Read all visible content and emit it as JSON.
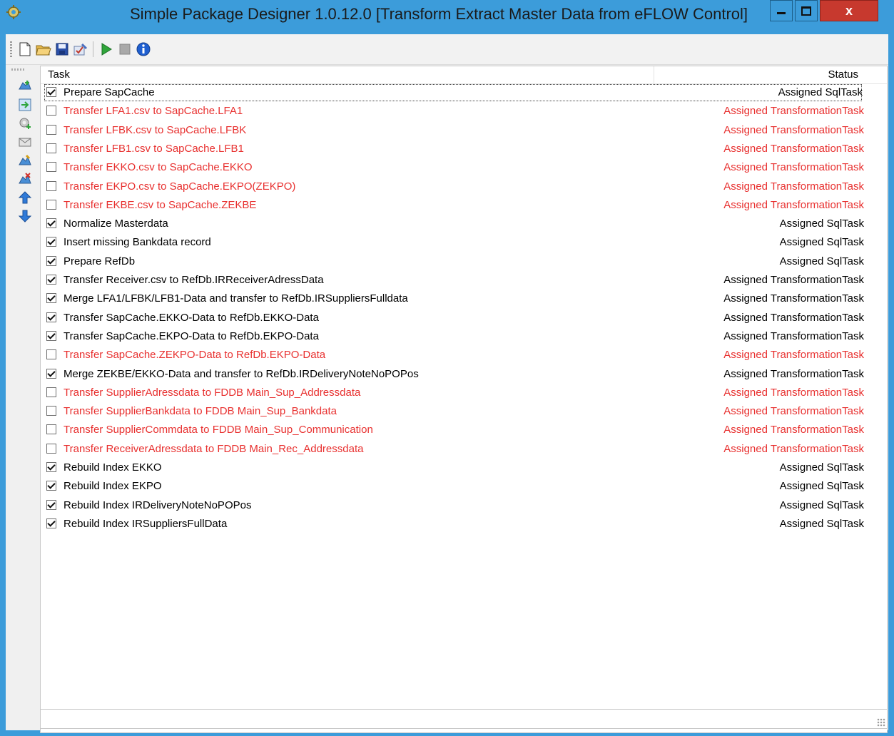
{
  "window": {
    "title": "Simple Package Designer 1.0.12.0 [Transform Extract Master Data from eFLOW Control]",
    "close_glyph": "x"
  },
  "toolbar": {
    "buttons": [
      "new-file-icon",
      "open-folder-icon",
      "save-icon",
      "edit-check-icon",
      "run-icon",
      "stop-icon",
      "info-icon"
    ]
  },
  "sidebar": {
    "buttons": [
      "add-task-icon",
      "add-transformation-icon",
      "add-sql-icon",
      "add-mail-icon",
      "edit-task-icon",
      "remove-task-icon",
      "move-up-icon",
      "move-down-icon"
    ]
  },
  "list": {
    "columns": {
      "task": "Task",
      "status": "Status"
    },
    "rows": [
      {
        "name": "Prepare SapCache",
        "status": "Assigned SqlTask",
        "checked": true,
        "color": "black"
      },
      {
        "name": "Transfer LFA1.csv to SapCache.LFA1",
        "status": "Assigned TransformationTask",
        "checked": false,
        "color": "red"
      },
      {
        "name": "Transfer LFBK.csv to SapCache.LFBK",
        "status": "Assigned TransformationTask",
        "checked": false,
        "color": "red"
      },
      {
        "name": "Transfer LFB1.csv to SapCache.LFB1",
        "status": "Assigned TransformationTask",
        "checked": false,
        "color": "red"
      },
      {
        "name": "Transfer EKKO.csv to SapCache.EKKO",
        "status": "Assigned TransformationTask",
        "checked": false,
        "color": "red"
      },
      {
        "name": "Transfer EKPO.csv to SapCache.EKPO(ZEKPO)",
        "status": "Assigned TransformationTask",
        "checked": false,
        "color": "red"
      },
      {
        "name": "Transfer EKBE.csv to SapCache.ZEKBE",
        "status": "Assigned TransformationTask",
        "checked": false,
        "color": "red"
      },
      {
        "name": "Normalize Masterdata",
        "status": "Assigned SqlTask",
        "checked": true,
        "color": "black"
      },
      {
        "name": "Insert missing Bankdata record",
        "status": "Assigned SqlTask",
        "checked": true,
        "color": "black"
      },
      {
        "name": "Prepare RefDb",
        "status": "Assigned SqlTask",
        "checked": true,
        "color": "black"
      },
      {
        "name": "Transfer Receiver.csv to RefDb.IRReceiverAdressData",
        "status": "Assigned TransformationTask",
        "checked": true,
        "color": "black"
      },
      {
        "name": "Merge LFA1/LFBK/LFB1-Data and transfer to RefDb.IRSuppliersFulldata",
        "status": "Assigned TransformationTask",
        "checked": true,
        "color": "black"
      },
      {
        "name": "Transfer SapCache.EKKO-Data to RefDb.EKKO-Data",
        "status": "Assigned TransformationTask",
        "checked": true,
        "color": "black"
      },
      {
        "name": "Transfer SapCache.EKPO-Data to RefDb.EKPO-Data",
        "status": "Assigned TransformationTask",
        "checked": true,
        "color": "black"
      },
      {
        "name": "Transfer SapCache.ZEKPO-Data to RefDb.EKPO-Data",
        "status": "Assigned TransformationTask",
        "checked": false,
        "color": "red"
      },
      {
        "name": "Merge ZEKBE/EKKO-Data and transfer to RefDb.IRDeliveryNoteNoPOPos",
        "status": "Assigned TransformationTask",
        "checked": true,
        "color": "black"
      },
      {
        "name": "Transfer SupplierAdressdata to FDDB Main_Sup_Addressdata",
        "status": "Assigned TransformationTask",
        "checked": false,
        "color": "red"
      },
      {
        "name": "Transfer SupplierBankdata to FDDB Main_Sup_Bankdata",
        "status": "Assigned TransformationTask",
        "checked": false,
        "color": "red"
      },
      {
        "name": "Transfer SupplierCommdata to FDDB Main_Sup_Communication",
        "status": "Assigned TransformationTask",
        "checked": false,
        "color": "red"
      },
      {
        "name": "Transfer ReceiverAdressdata to FDDB Main_Rec_Addressdata",
        "status": "Assigned TransformationTask",
        "checked": false,
        "color": "red"
      },
      {
        "name": "Rebuild Index EKKO",
        "status": "Assigned SqlTask",
        "checked": true,
        "color": "black"
      },
      {
        "name": "Rebuild Index EKPO",
        "status": "Assigned SqlTask",
        "checked": true,
        "color": "black"
      },
      {
        "name": "Rebuild Index IRDeliveryNoteNoPOPos",
        "status": "Assigned SqlTask",
        "checked": true,
        "color": "black"
      },
      {
        "name": "Rebuild Index IRSuppliersFullData",
        "status": "Assigned SqlTask",
        "checked": true,
        "color": "black"
      }
    ]
  },
  "statusbar": {
    "text": ""
  }
}
